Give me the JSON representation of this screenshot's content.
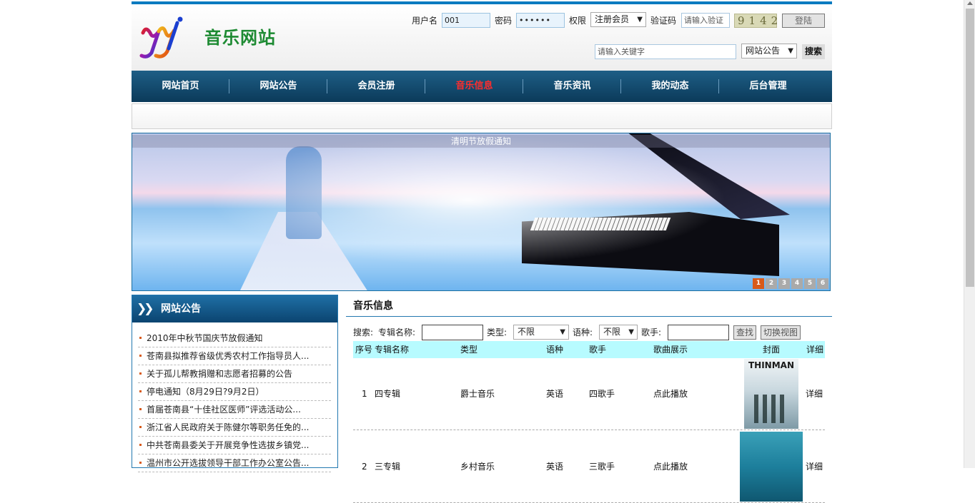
{
  "header": {
    "site_title": "音乐网站",
    "logo_text": "yj",
    "username_label": "用户名",
    "username_value": "001",
    "password_label": "密码",
    "password_value": "••••••",
    "role_label": "权限",
    "role_value": "注册会员",
    "captcha_label": "验证码",
    "captcha_placeholder": "请输入验证",
    "captcha_code": "9142",
    "login_button": "登陆",
    "search_placeholder": "请输入关键字",
    "search_scope": "网站公告",
    "search_button": "搜索"
  },
  "nav": {
    "items": [
      {
        "label": "网站首页"
      },
      {
        "label": "网站公告"
      },
      {
        "label": "会员注册"
      },
      {
        "label": "音乐信息"
      },
      {
        "label": "音乐资讯"
      },
      {
        "label": "我的动态"
      },
      {
        "label": "后台管理"
      }
    ],
    "active_index": 3,
    "active_color": "#ff2d2d"
  },
  "banner": {
    "caption": "清明节放假通知",
    "pages": [
      "1",
      "2",
      "3",
      "4",
      "5",
      "6"
    ],
    "active_page": 0
  },
  "sidebar": {
    "title": "网站公告",
    "items": [
      {
        "text": "2010年中秋节国庆节放假通知"
      },
      {
        "text": "苍南县拟推荐省级优秀农村工作指导员人..."
      },
      {
        "text": "关于孤儿帮教捐赠和志愿者招募的公告"
      },
      {
        "text": "停电通知（8月29日?9月2日）"
      },
      {
        "text": "首届苍南县“十佳社区医师”评选活动公..."
      },
      {
        "text": "浙江省人民政府关于陈健尔等职务任免的..."
      },
      {
        "text": "中共苍南县委关于开展竞争性选拔乡镇党..."
      },
      {
        "text": "温州市公开选拔领导干部工作办公室公告..."
      }
    ]
  },
  "main": {
    "title": "音乐信息",
    "search": {
      "label": "搜索:",
      "album_label": "专辑名称:",
      "type_label": "类型:",
      "type_value": "不限",
      "lang_label": "语种:",
      "lang_value": "不限",
      "singer_label": "歌手:",
      "find_button": "查找",
      "switch_button": "切换视图"
    },
    "columns": [
      "序号",
      "专辑名称",
      "类型",
      "语种",
      "歌手",
      "歌曲展示",
      "封面",
      "详细"
    ],
    "rows": [
      {
        "no": "1",
        "album": "四专辑",
        "type": "爵士音乐",
        "lang": "英语",
        "singer": "四歌手",
        "show": "点此播放",
        "cover_text": "THINMAN",
        "detail": "详细"
      },
      {
        "no": "2",
        "album": "三专辑",
        "type": "乡村音乐",
        "lang": "英语",
        "singer": "三歌手",
        "show": "点此播放",
        "cover_text": "",
        "detail": "详细"
      }
    ]
  }
}
